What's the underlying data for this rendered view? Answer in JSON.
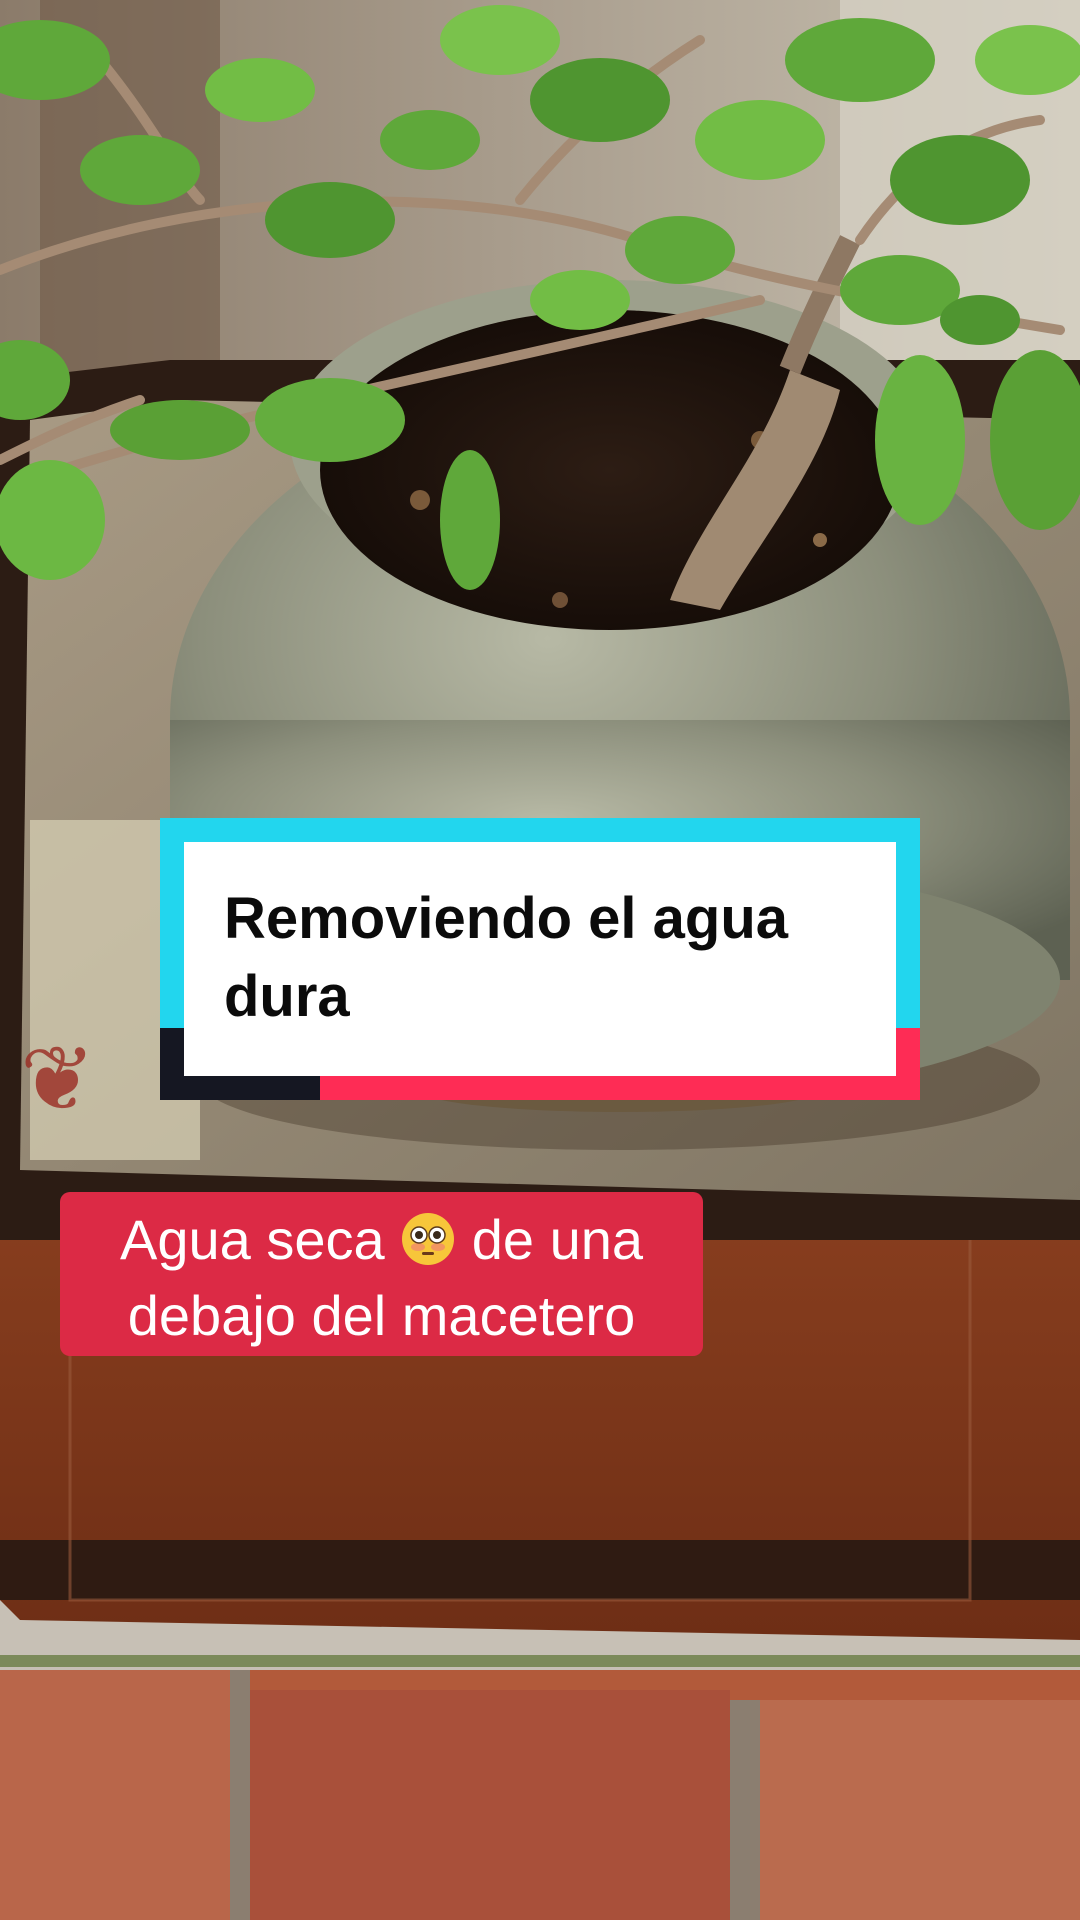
{
  "title_card": {
    "text": "Removiendo el agua dura"
  },
  "caption": {
    "line1_before": "Agua seca",
    "emoji": "flushed-face-emoji",
    "line1_after": "de una",
    "line2": "debajo del macetero"
  },
  "colors": {
    "title_accent_cyan": "#22d6ee",
    "title_accent_red": "#fe2c55",
    "title_accent_dark": "#151722",
    "caption_background": "#dc2a45"
  }
}
